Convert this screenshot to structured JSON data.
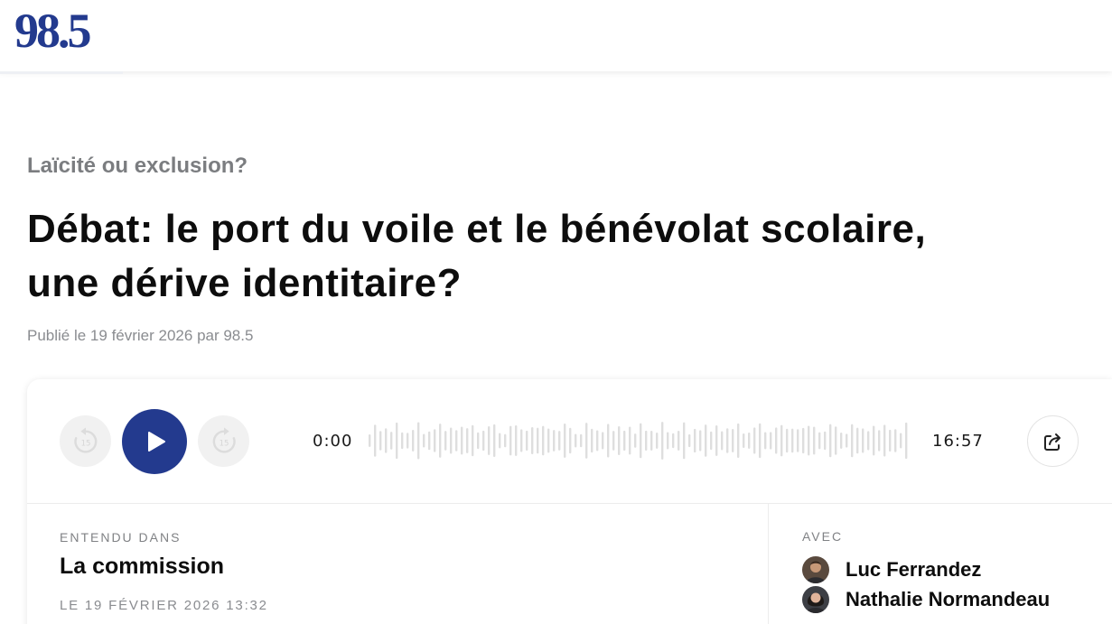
{
  "brand": {
    "logo_text": "98.5",
    "color": "#233a8e"
  },
  "article": {
    "kicker": "Laïcité ou exclusion?",
    "headline_line1": "Débat: le port du voile et le bénévolat scolaire,",
    "headline_line2": "une dérive identitaire?",
    "byline": "Publié le 19 février 2026 par 98.5"
  },
  "player": {
    "current_time": "0:00",
    "duration": "16:57",
    "skip_back_seconds": "15",
    "skip_forward_seconds": "15",
    "icons": {
      "skip_back": "rewind-15-icon",
      "play": "play-icon",
      "skip_forward": "forward-15-icon",
      "share": "share-icon"
    },
    "progress": 0
  },
  "episode": {
    "heard_in_label": "ENTENDU DANS",
    "show_name": "La commission",
    "air_date": "LE 19 FÉVRIER 2026 13:32"
  },
  "participants": {
    "label": "AVEC",
    "people": [
      {
        "name": "Luc Ferrandez"
      },
      {
        "name": "Nathalie Normandeau"
      }
    ]
  }
}
